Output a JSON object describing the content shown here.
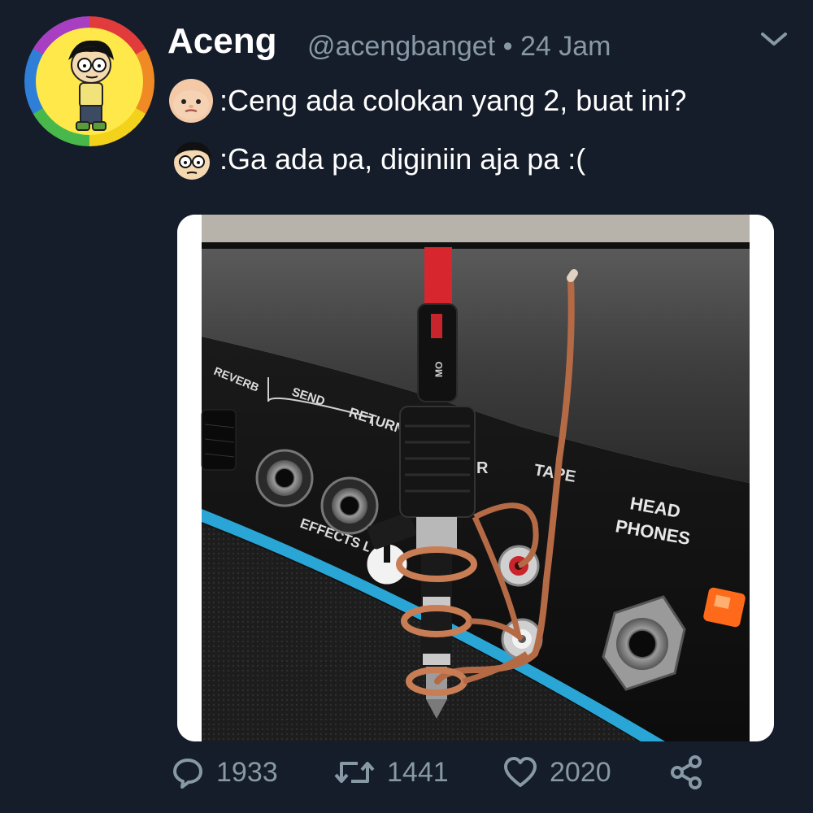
{
  "tweet": {
    "name": "Aceng",
    "handle": "@acengbanget • 24 Jam",
    "lines": [
      {
        "emoji": "boss-baby-face-icon",
        "text": ":Ceng ada colokan yang 2, buat ini?"
      },
      {
        "emoji": "aceng-face-icon",
        "text": ":Ga ada pa, diginiin aja pa :("
      }
    ],
    "photo_labels": {
      "reverb": "REVERB",
      "send": "SEND",
      "return": "RETURN",
      "effects": "EFFECTS L",
      "tape": "TAPE",
      "head": "HEAD",
      "phones": "PHONES",
      "tape_left": "R",
      "plug_mark": "MO"
    },
    "actions": {
      "reply_count": "1933",
      "retweet_count": "1441",
      "like_count": "2020"
    }
  },
  "colors": {
    "background": "#151c2a",
    "muted": "#8899a6",
    "accent_cable": "#d7262e",
    "amp_stripe": "#2aa6d6",
    "copper": "#b56a46"
  }
}
